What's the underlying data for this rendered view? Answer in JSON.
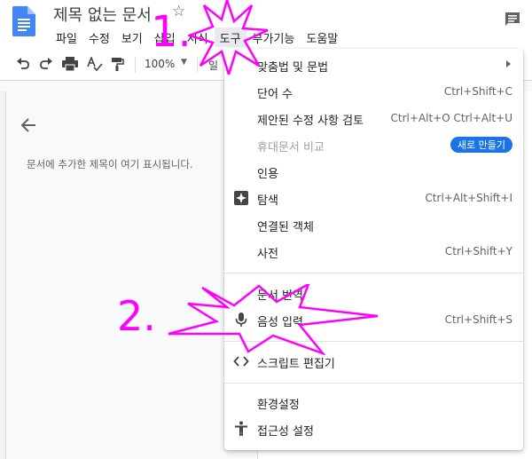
{
  "app": {
    "doc_title": "제목 없는 문서",
    "star_icon": "star-outline-icon",
    "comment_icon": "comment-icon"
  },
  "menubar": {
    "items": [
      "파일",
      "수정",
      "보기",
      "삽입",
      "서식",
      "도구",
      "부가기능",
      "도움말"
    ]
  },
  "toolbar": {
    "zoom": "100%",
    "style_label": "일"
  },
  "outline": {
    "placeholder": "문서에 추가한 제목이 여기 표시됩니다."
  },
  "tools_menu": {
    "items": [
      {
        "label": "맞춤법 및 문법",
        "shortcut": ""
      },
      {
        "label": "단어 수",
        "shortcut": "Ctrl+Shift+C"
      },
      {
        "label": "제안된 수정 사항 검토",
        "shortcut": "Ctrl+Alt+O Ctrl+Alt+U"
      },
      {
        "label": "휴대문서 비교",
        "badge": "새로 만들기"
      },
      {
        "label": "인용",
        "shortcut": ""
      },
      {
        "label": "탐색",
        "shortcut": "Ctrl+Alt+Shift+I"
      },
      {
        "label": "연결된 객체",
        "shortcut": ""
      },
      {
        "label": "사전",
        "shortcut": "Ctrl+Shift+Y"
      },
      {
        "label": "문서 번역",
        "shortcut": ""
      },
      {
        "label": "음성 입력",
        "shortcut": "Ctrl+Shift+S"
      },
      {
        "label": "스크립트 편집기",
        "shortcut": ""
      },
      {
        "label": "환경설정",
        "shortcut": ""
      },
      {
        "label": "접근성 설정",
        "shortcut": ""
      }
    ]
  },
  "annotations": {
    "step1": "1.",
    "step2": "2."
  },
  "colors": {
    "annotation": "#ff00ff",
    "accent": "#1a73e8"
  }
}
